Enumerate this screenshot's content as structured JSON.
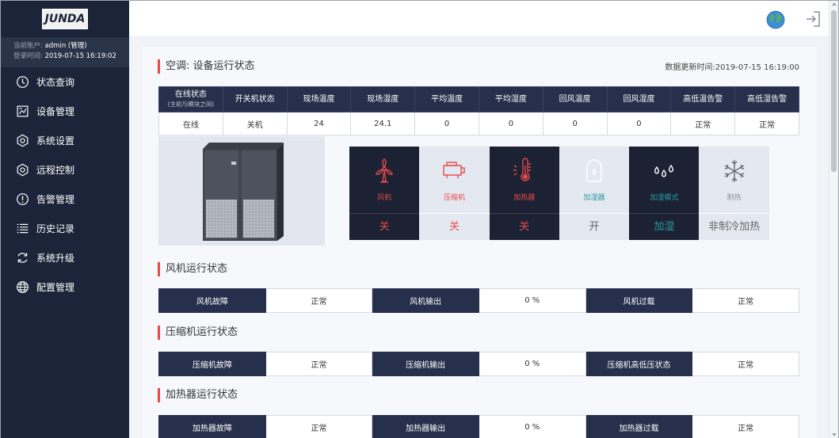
{
  "brand": {
    "logo": "JUNDA"
  },
  "account": {
    "user_label": "当前账户:",
    "user_value": "admin (管理)",
    "login_label": "登录时间:",
    "login_value": "2019-07-15 16:19:02"
  },
  "nav": [
    {
      "label": "状态查询",
      "icon": "clock-icon"
    },
    {
      "label": "设备管理",
      "icon": "device-icon"
    },
    {
      "label": "系统设置",
      "icon": "gear-icon"
    },
    {
      "label": "远程控制",
      "icon": "gear-icon"
    },
    {
      "label": "告警管理",
      "icon": "alert-icon"
    },
    {
      "label": "历史记录",
      "icon": "list-icon"
    },
    {
      "label": "系统升级",
      "icon": "refresh-icon"
    },
    {
      "label": "配置管理",
      "icon": "globe-icon"
    }
  ],
  "page": {
    "title": "空调: 设备运行状态",
    "update_time": "数据更新时间:2019-07-15 16:19:00"
  },
  "status_table": {
    "headers": [
      {
        "label": "在线状态",
        "sub": "(主机与模块之间)"
      },
      {
        "label": "开关机状态",
        "sub": ""
      },
      {
        "label": "现场温度",
        "sub": ""
      },
      {
        "label": "现场湿度",
        "sub": ""
      },
      {
        "label": "平均温度",
        "sub": ""
      },
      {
        "label": "平均湿度",
        "sub": ""
      },
      {
        "label": "回风温度",
        "sub": ""
      },
      {
        "label": "回风湿度",
        "sub": ""
      },
      {
        "label": "高低温告警",
        "sub": ""
      },
      {
        "label": "高低湿告警",
        "sub": ""
      }
    ],
    "values": [
      "在线",
      "关机",
      "24",
      "24.1",
      "0",
      "0",
      "0",
      "0",
      "正常",
      "正常"
    ]
  },
  "tiles": [
    {
      "name": "风机",
      "value": "关",
      "icon": "fan-icon"
    },
    {
      "name": "压缩机",
      "value": "关",
      "icon": "compressor-icon"
    },
    {
      "name": "加热器",
      "value": "关",
      "icon": "heater-icon"
    },
    {
      "name": "加湿器",
      "value": "开",
      "icon": "humidifier-icon"
    },
    {
      "name": "加湿模式",
      "value": "加湿",
      "icon": "droplets-icon"
    },
    {
      "name": "制热",
      "value": "非制冷加热",
      "icon": "snowflake-icon"
    }
  ],
  "sections": [
    {
      "title": "风机运行状态",
      "cells": [
        {
          "k": "风机故障",
          "v": "正常"
        },
        {
          "k": "风机输出",
          "v": "0 %"
        },
        {
          "k": "风机过载",
          "v": "正常"
        }
      ]
    },
    {
      "title": "压缩机运行状态",
      "cells": [
        {
          "k": "压缩机故障",
          "v": "正常"
        },
        {
          "k": "压缩机输出",
          "v": "0 %"
        },
        {
          "k": "压缩机高低压状态",
          "v": "正常"
        }
      ]
    },
    {
      "title": "加热器运行状态",
      "cells": [
        {
          "k": "加热器故障",
          "v": "正常"
        },
        {
          "k": "加热器输出",
          "v": "0 %"
        },
        {
          "k": "加热器过载",
          "v": "正常"
        }
      ]
    }
  ],
  "colors": {
    "sidebar": "#1b2438",
    "accent": "#e64a4a",
    "header": "#262f4b",
    "teal": "#2a9aa3"
  }
}
